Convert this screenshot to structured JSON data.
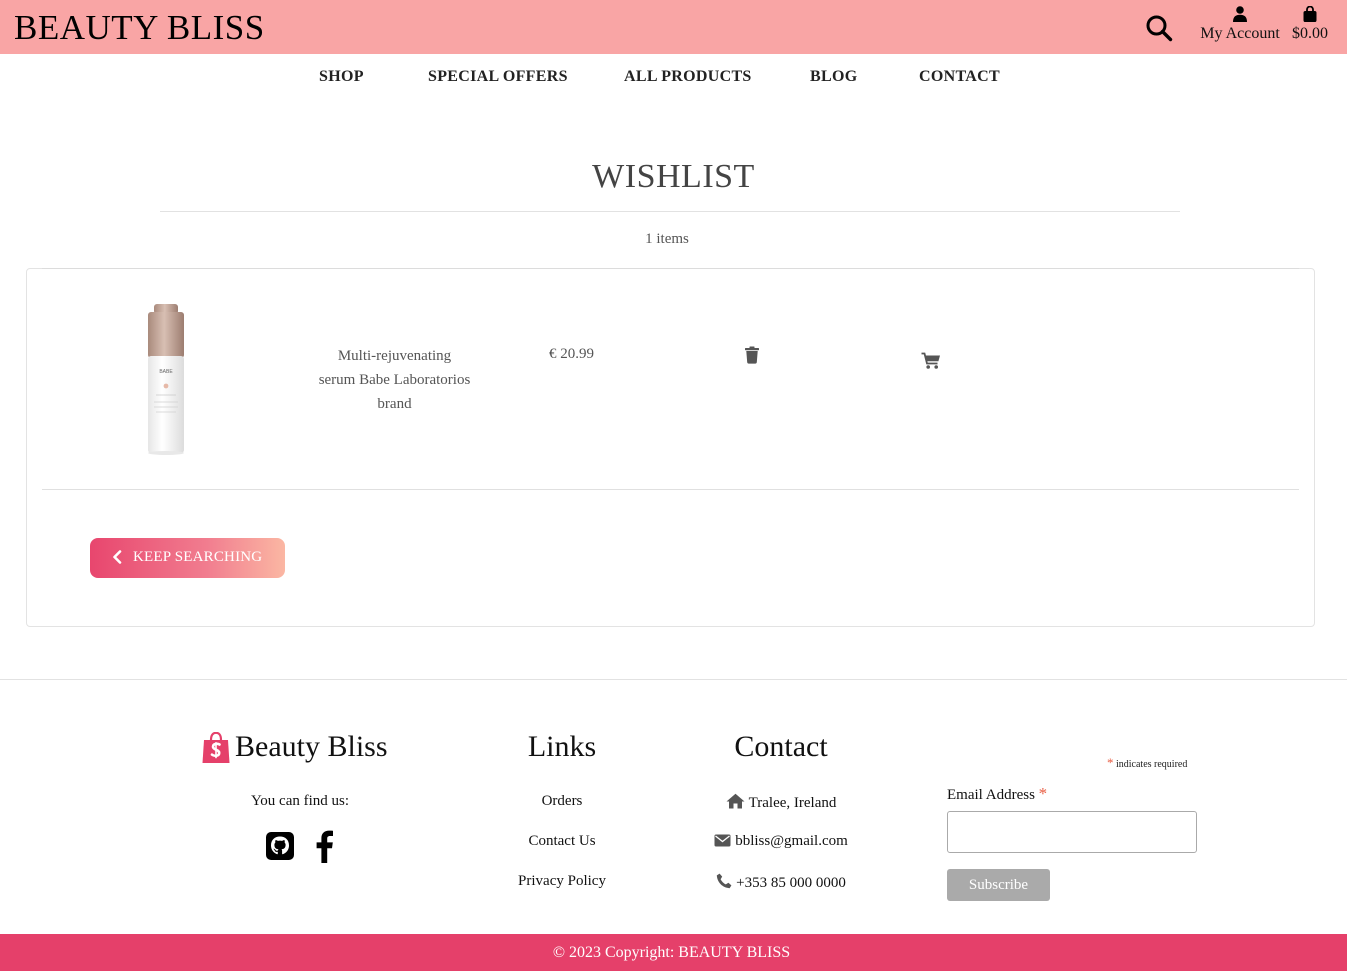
{
  "header": {
    "brand": "BEAUTY BLISS",
    "account_label": "My Account",
    "bag_total": "$0.00",
    "bg_color": "#f9a5a5"
  },
  "nav": {
    "items": [
      "SHOP",
      "SPECIAL OFFERS",
      "ALL PRODUCTS",
      "BLOG",
      "CONTACT"
    ]
  },
  "wishlist": {
    "title": "WISHLIST",
    "count_text": "1 items",
    "items": [
      {
        "name": "Multi-rejuvenating serum Babe Laboratorios brand",
        "price": "€ 20.99",
        "image_icon": "serum-bottle",
        "product_label": "BABE"
      }
    ],
    "keep_searching_label": "KEEP SEARCHING",
    "accent_color": "#e8466e"
  },
  "footer": {
    "brand": "Beauty Bliss",
    "find_us": "You can find us:",
    "social": [
      "github-icon",
      "facebook-icon"
    ],
    "links_title": "Links",
    "links": [
      "Orders",
      "Contact Us",
      "Privacy Policy"
    ],
    "contact_title": "Contact",
    "contact": {
      "address": "Tralee, Ireland",
      "email": "bbliss@gmail.com",
      "phone": "+353 85 000 0000"
    },
    "newsletter": {
      "required_note": "indicates required",
      "email_label": "Email Address",
      "email_value": "",
      "subscribe_label": "Subscribe"
    },
    "copyright": "© 2023 Copyright: BEAUTY BLISS",
    "copyright_bg": "#e5406a"
  }
}
